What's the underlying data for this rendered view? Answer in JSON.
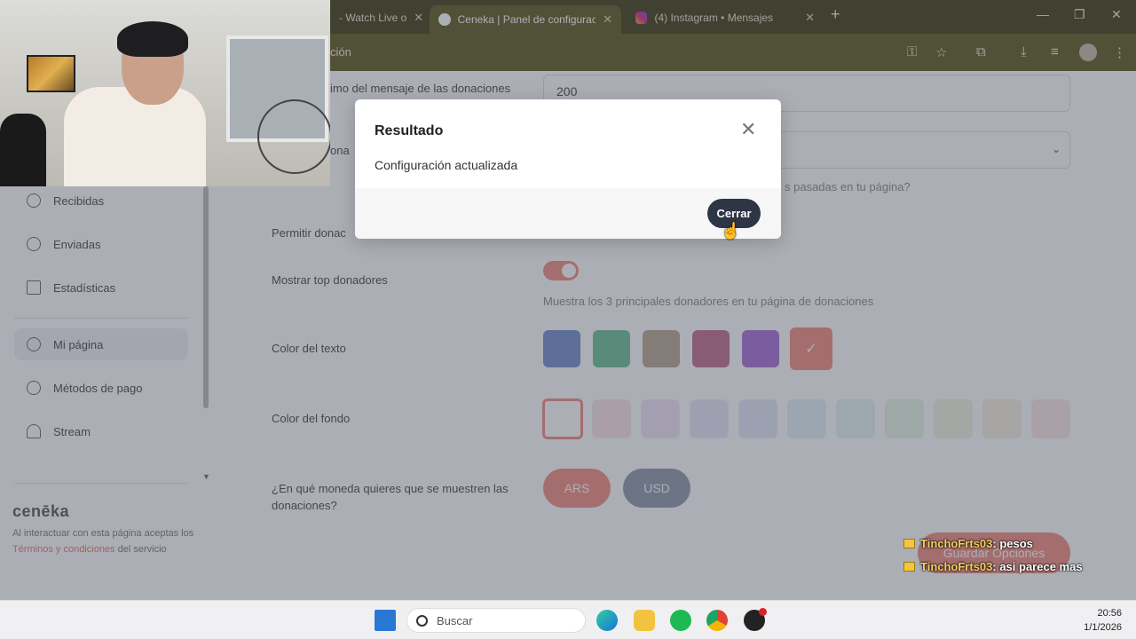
{
  "browser": {
    "tabs": [
      {
        "label": "- Watch Live o",
        "active": false
      },
      {
        "label": "Ceneka | Panel de configuración",
        "active": true
      },
      {
        "label": "(4) Instagram • Mensajes",
        "active": false
      }
    ],
    "url_fragment": "ción"
  },
  "sidebar": {
    "items": [
      {
        "label": "Recibidas"
      },
      {
        "label": "Enviadas"
      },
      {
        "label": "Estadísticas"
      },
      {
        "label": "Mi página"
      },
      {
        "label": "Métodos de pago"
      },
      {
        "label": "Stream"
      }
    ],
    "logo": "cenēka",
    "footer_prefix": "Al interactuar con esta página aceptas los ",
    "footer_link": "Términos y condiciones",
    "footer_suffix": " del servicio"
  },
  "form": {
    "max_message_label": "imo del mensaje de las donaciones",
    "max_message_value": "200",
    "donations_label": "ona",
    "donations_helper": "s pasadas en tu página?",
    "allow_label": "Permitir donac",
    "top_donors_label": "Mostrar top donadores",
    "top_donors_helper": "Muestra los 3 principales donadores en tu página de donaciones",
    "text_color_label": "Color del texto",
    "text_colors": [
      "#6f8ccc",
      "#6bbf94",
      "#b5a48e",
      "#c06a8c",
      "#a66ad8",
      "#f08a7e"
    ],
    "bg_color_label": "Color del fondo",
    "bg_colors": [
      "#ffffff",
      "#fbe3ea",
      "#f1e2f7",
      "#e9e4f9",
      "#e2e8f9",
      "#e1f1f8",
      "#e0f5f1",
      "#e6f4e5",
      "#f1f5e1",
      "#f6f1e0",
      "#fce6e6"
    ],
    "currency_label": "¿En qué moneda quieres que se muestren las donaciones?",
    "currency_ars": "ARS",
    "currency_usd": "USD",
    "save_label": "Guardar Opciones"
  },
  "modal": {
    "title": "Resultado",
    "message": "Configuración actualizada",
    "close_button": "Cerrar"
  },
  "chat": [
    {
      "user": "TinchoFrts03",
      "message": " : pesos"
    },
    {
      "user": "TinchoFrts03",
      "message": " : asi parece mas"
    }
  ],
  "taskbar": {
    "search_placeholder": "Buscar",
    "time": "20:56",
    "date": "1/1/2026"
  }
}
